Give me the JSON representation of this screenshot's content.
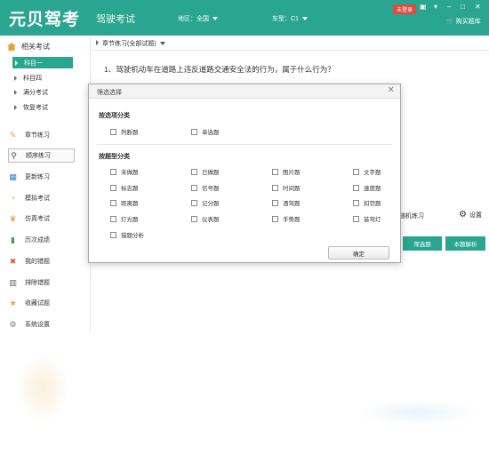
{
  "app": {
    "logo": "元贝驾考",
    "subtitle": "驾驶考试",
    "region_label": "地区：全国",
    "cartype_label": "车型：C1",
    "user_badge": "未登录",
    "window_controls": [
      "▣",
      "▾",
      "–",
      "□",
      "✕"
    ],
    "my_cart": "购买题库"
  },
  "sidebar": {
    "header": "相关考试",
    "sub_items": [
      "科目一",
      "科目四",
      "满分考试",
      "恢复考试"
    ],
    "nav": [
      {
        "label": "章节练习",
        "icon": "pencil-icon"
      },
      {
        "label": "顺序练习",
        "icon": "search-icon"
      },
      {
        "label": "更新练习",
        "icon": "chart-icon"
      },
      {
        "label": "模拟考试",
        "icon": "clock-icon"
      },
      {
        "label": "仿真考试",
        "icon": "trophy-icon"
      },
      {
        "label": "历次成绩",
        "icon": "bar-chart-icon"
      },
      {
        "label": "我的错题",
        "icon": "cross-icon"
      },
      {
        "label": "排除错题",
        "icon": "trash-icon"
      },
      {
        "label": "收藏试题",
        "icon": "star-icon"
      },
      {
        "label": "系统设置",
        "icon": "gear-icon"
      }
    ]
  },
  "main": {
    "breadcrumb": "章节练习(全部试题)",
    "question": "1、驾驶机动车在道路上违反道路交通安全法的行为，属于什么行为？",
    "practice_mode": "随机练习",
    "settings": "设置",
    "buttons": [
      "筛选题",
      "本题解析"
    ]
  },
  "modal": {
    "title": "筛选选择",
    "close": "✕",
    "section1": "按选项分类",
    "section1_options": [
      "判断题",
      "单选题"
    ],
    "section2": "按题型分类",
    "section2_options": [
      "未做题",
      "已做题",
      "图片题",
      "文字题",
      "标志题",
      "信号题",
      "时间题",
      "速度题",
      "距离题",
      "记分题",
      "酒驾题",
      "扣罚题",
      "灯光题",
      "仪表题",
      "手势题",
      "装驾灯",
      "错题分析"
    ],
    "ok": "确定"
  }
}
